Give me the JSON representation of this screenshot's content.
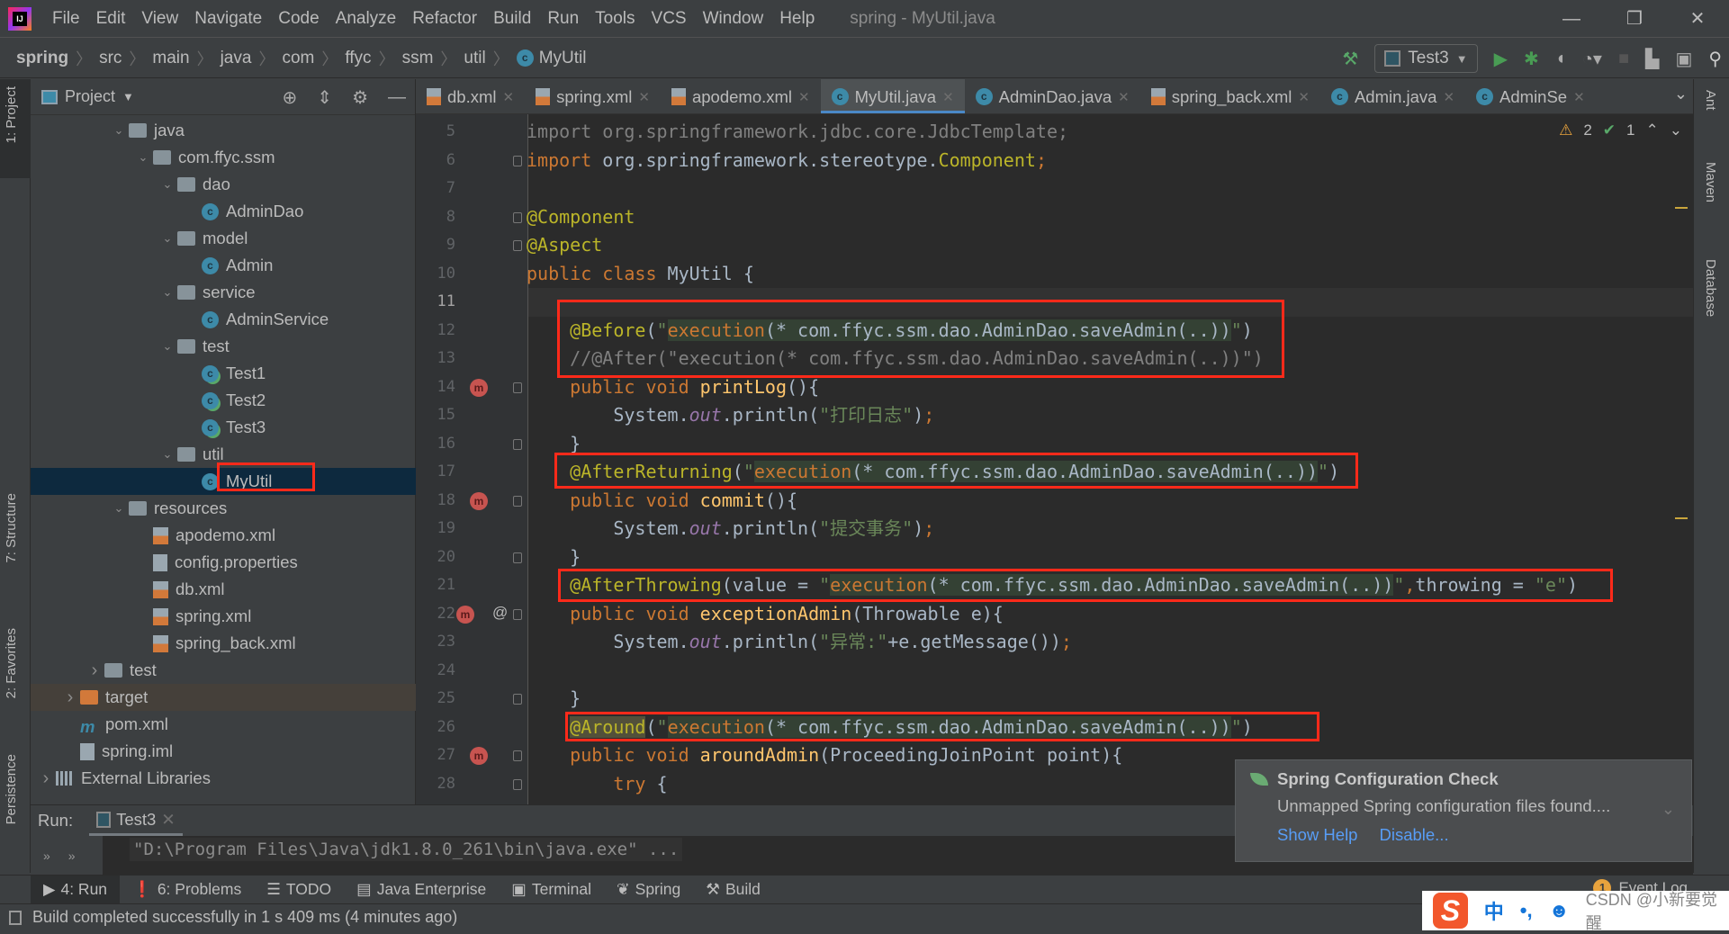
{
  "window": {
    "title": "spring - MyUtil.java",
    "controls": [
      "—",
      "❐",
      "✕"
    ]
  },
  "menu": [
    "File",
    "Edit",
    "View",
    "Navigate",
    "Code",
    "Analyze",
    "Refactor",
    "Build",
    "Run",
    "Tools",
    "VCS",
    "Window",
    "Help"
  ],
  "breadcrumb": [
    "spring",
    "src",
    "main",
    "java",
    "com",
    "ffyc",
    "ssm",
    "util",
    "MyUtil"
  ],
  "toolbar": {
    "run_config": "Test3"
  },
  "left_strip": [
    "1: Project",
    "7: Structure",
    "2: Favorites",
    "Persistence"
  ],
  "right_strip": [
    "Ant",
    "Maven",
    "Database"
  ],
  "project": {
    "title": "Project",
    "tree": [
      {
        "label": "java",
        "type": "folder",
        "depth": 0,
        "expanded": true
      },
      {
        "label": "com.ffyc.ssm",
        "type": "folder",
        "depth": 1,
        "expanded": true
      },
      {
        "label": "dao",
        "type": "folder",
        "depth": 2,
        "expanded": true
      },
      {
        "label": "AdminDao",
        "type": "class",
        "depth": 3
      },
      {
        "label": "model",
        "type": "folder",
        "depth": 2,
        "expanded": true
      },
      {
        "label": "Admin",
        "type": "class",
        "depth": 3
      },
      {
        "label": "service",
        "type": "folder",
        "depth": 2,
        "expanded": true
      },
      {
        "label": "AdminService",
        "type": "class",
        "depth": 3
      },
      {
        "label": "test",
        "type": "folder",
        "depth": 2,
        "expanded": true
      },
      {
        "label": "Test1",
        "type": "runclass",
        "depth": 3
      },
      {
        "label": "Test2",
        "type": "runclass",
        "depth": 3
      },
      {
        "label": "Test3",
        "type": "runclass",
        "depth": 3
      },
      {
        "label": "util",
        "type": "folder",
        "depth": 2,
        "expanded": true
      },
      {
        "label": "MyUtil",
        "type": "class",
        "depth": 3,
        "selected": true
      },
      {
        "label": "resources",
        "type": "folder",
        "depth": 0,
        "expanded": true
      },
      {
        "label": "apodemo.xml",
        "type": "xml",
        "depth": 1
      },
      {
        "label": "config.properties",
        "type": "prop",
        "depth": 1
      },
      {
        "label": "db.xml",
        "type": "xml",
        "depth": 1
      },
      {
        "label": "spring.xml",
        "type": "xml",
        "depth": 1
      },
      {
        "label": "spring_back.xml",
        "type": "xml",
        "depth": 1
      },
      {
        "label": "test",
        "type": "folder",
        "depth": -1,
        "expanded": false
      },
      {
        "label": "target",
        "type": "orangefolder",
        "depth": -2,
        "expanded": false,
        "excluded": true
      },
      {
        "label": "pom.xml",
        "type": "maven",
        "depth": -2
      },
      {
        "label": "spring.iml",
        "type": "prop",
        "depth": -2
      },
      {
        "label": "External Libraries",
        "type": "lib",
        "depth": -3,
        "expanded": false
      }
    ]
  },
  "tabs": [
    {
      "label": "db.xml",
      "icon": "xml"
    },
    {
      "label": "spring.xml",
      "icon": "xml"
    },
    {
      "label": "apodemo.xml",
      "icon": "xml"
    },
    {
      "label": "MyUtil.java",
      "icon": "class",
      "active": true
    },
    {
      "label": "AdminDao.java",
      "icon": "class"
    },
    {
      "label": "spring_back.xml",
      "icon": "xml"
    },
    {
      "label": "Admin.java",
      "icon": "class"
    },
    {
      "label": "AdminSe",
      "icon": "class"
    }
  ],
  "inspections": {
    "warnings": "2",
    "ok": "1"
  },
  "editor": {
    "current_line": 11,
    "lines": [
      {
        "n": 5,
        "seg": [
          [
            "u",
            "import org.springframework.jdbc.core.JdbcTemplate;"
          ]
        ]
      },
      {
        "n": 6,
        "seg": [
          [
            "k",
            "import"
          ],
          [
            "t",
            " org.springframework.stereotype."
          ],
          [
            "a",
            "Component"
          ],
          [
            "k",
            ";"
          ]
        ]
      },
      {
        "n": 7,
        "seg": []
      },
      {
        "n": 8,
        "seg": [
          [
            "a",
            "@Component"
          ]
        ]
      },
      {
        "n": 9,
        "seg": [
          [
            "a",
            "@Aspect"
          ]
        ]
      },
      {
        "n": 10,
        "seg": [
          [
            "k",
            "public class "
          ],
          [
            "t",
            "MyUtil {"
          ]
        ]
      },
      {
        "n": 11,
        "seg": []
      },
      {
        "n": 12,
        "seg": [
          [
            "t",
            "    "
          ],
          [
            "a",
            "@Before"
          ],
          [
            "t",
            "("
          ],
          [
            "s",
            "\""
          ],
          [
            "pk",
            "execution"
          ],
          [
            "pb",
            "(* com.ffyc.ssm.dao.AdminDao.saveAdmin(..))"
          ],
          [
            "s",
            "\""
          ],
          [
            "t",
            ")"
          ]
        ]
      },
      {
        "n": 13,
        "seg": [
          [
            "c",
            "    //@After(\"execution(* com.ffyc.ssm.dao.AdminDao.saveAdmin(..))\")"
          ]
        ]
      },
      {
        "n": 14,
        "seg": [
          [
            "t",
            "    "
          ],
          [
            "k",
            "public void "
          ],
          [
            "m",
            "printLog"
          ],
          [
            "t",
            "(){"
          ]
        ]
      },
      {
        "n": 15,
        "seg": [
          [
            "t",
            "        System."
          ],
          [
            "f",
            "out"
          ],
          [
            "t",
            ".println("
          ],
          [
            "s",
            "\"打印日志\""
          ],
          [
            "t",
            ")"
          ],
          [
            "k",
            ";"
          ]
        ]
      },
      {
        "n": 16,
        "seg": [
          [
            "t",
            "    }"
          ]
        ]
      },
      {
        "n": 17,
        "seg": [
          [
            "t",
            "    "
          ],
          [
            "a",
            "@AfterReturning"
          ],
          [
            "t",
            "("
          ],
          [
            "s",
            "\""
          ],
          [
            "pk",
            "execution"
          ],
          [
            "pb",
            "(* com.ffyc.ssm.dao.AdminDao.saveAdmin(..))"
          ],
          [
            "s",
            "\""
          ],
          [
            "t",
            ")"
          ]
        ]
      },
      {
        "n": 18,
        "seg": [
          [
            "t",
            "    "
          ],
          [
            "k",
            "public void "
          ],
          [
            "m",
            "commit"
          ],
          [
            "t",
            "(){"
          ]
        ]
      },
      {
        "n": 19,
        "seg": [
          [
            "t",
            "        System."
          ],
          [
            "f",
            "out"
          ],
          [
            "t",
            ".println("
          ],
          [
            "s",
            "\"提交事务\""
          ],
          [
            "t",
            ")"
          ],
          [
            "k",
            ";"
          ]
        ]
      },
      {
        "n": 20,
        "seg": [
          [
            "t",
            "    }"
          ]
        ]
      },
      {
        "n": 21,
        "seg": [
          [
            "t",
            "    "
          ],
          [
            "a",
            "@AfterThrowing"
          ],
          [
            "t",
            "(value = "
          ],
          [
            "s",
            "\""
          ],
          [
            "pk",
            "execution"
          ],
          [
            "pb",
            "(* com.ffyc.ssm.dao.AdminDao.saveAdmin(..))"
          ],
          [
            "s",
            "\""
          ],
          [
            "k",
            ","
          ],
          [
            "t",
            "throwing = "
          ],
          [
            "s",
            "\"e\""
          ],
          [
            "t",
            ")"
          ]
        ]
      },
      {
        "n": 22,
        "seg": [
          [
            "t",
            "    "
          ],
          [
            "k",
            "public void "
          ],
          [
            "m",
            "exceptionAdmin"
          ],
          [
            "t",
            "(Throwable e){"
          ]
        ]
      },
      {
        "n": 23,
        "seg": [
          [
            "t",
            "        System."
          ],
          [
            "f",
            "out"
          ],
          [
            "t",
            ".println("
          ],
          [
            "s",
            "\"异常:\""
          ],
          [
            "t",
            "+e.getMessage())"
          ],
          [
            "k",
            ";"
          ]
        ]
      },
      {
        "n": 24,
        "seg": []
      },
      {
        "n": 25,
        "seg": [
          [
            "t",
            "    }"
          ]
        ]
      },
      {
        "n": 26,
        "seg": [
          [
            "t",
            "    "
          ],
          [
            "ah",
            "@Around"
          ],
          [
            "t",
            "("
          ],
          [
            "s",
            "\""
          ],
          [
            "pk",
            "execution"
          ],
          [
            "pb",
            "(* com.ffyc.ssm.dao.AdminDao.saveAdmin(..))"
          ],
          [
            "s",
            "\""
          ],
          [
            "t",
            ")"
          ]
        ]
      },
      {
        "n": 27,
        "seg": [
          [
            "t",
            "    "
          ],
          [
            "k",
            "public void "
          ],
          [
            "m",
            "aroundAdmin"
          ],
          [
            "t",
            "(ProceedingJoinPoint point){"
          ]
        ]
      },
      {
        "n": 28,
        "seg": [
          [
            "t",
            "        "
          ],
          [
            "k",
            "try"
          ],
          [
            "t",
            " {"
          ]
        ]
      }
    ],
    "advice_gutter_lines": [
      14,
      18,
      22,
      27
    ],
    "at_gutter_lines": [
      22
    ],
    "fold_lines": [
      6,
      8,
      9,
      14,
      16,
      18,
      20,
      22,
      25,
      27,
      28
    ]
  },
  "run": {
    "label": "Run:",
    "tab": "Test3",
    "console": "\"D:\\Program Files\\Java\\jdk1.8.0_261\\bin\\java.exe\" ..."
  },
  "tool_windows": [
    {
      "label": "4: Run",
      "icon": "▶",
      "active": true
    },
    {
      "label": "6: Problems",
      "icon": "❗"
    },
    {
      "label": "TODO",
      "icon": "☰"
    },
    {
      "label": "Java Enterprise",
      "icon": "▤"
    },
    {
      "label": "Terminal",
      "icon": "▣"
    },
    {
      "label": "Spring",
      "icon": "❦"
    },
    {
      "label": "Build",
      "icon": "⚒"
    }
  ],
  "event_log": {
    "count": "1",
    "label": "Event Log"
  },
  "status": "Build completed successfully in 1 s 409 ms (4 minutes ago)",
  "notification": {
    "title": "Spring Configuration Check",
    "message": "Unmapped Spring configuration files found....",
    "links": [
      "Show Help",
      "Disable..."
    ]
  },
  "ime": {
    "logo": "S",
    "items": [
      "中",
      "•,",
      "☻",
      "🎤",
      "▦",
      "⚙"
    ],
    "watermark": "CSDN @小新要觉醒"
  },
  "colors": {
    "accent": "#4a88c7",
    "highlight_box": "#ff2a1a",
    "selection": "#0d293e",
    "link": "#589df6"
  }
}
